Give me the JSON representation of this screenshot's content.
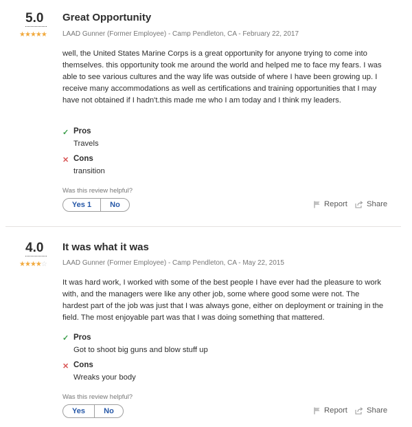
{
  "reviews": [
    {
      "rating": "5.0",
      "stars_filled": 5,
      "stars_total": 5,
      "title": "Great Opportunity",
      "meta": "LAAD Gunner (Former Employee) - Camp Pendleton, CA - February 22, 2017",
      "body": "well, the United States Marine Corps is a great opportunity for anyone trying to come into themselves. this opportunity took me around the world and helped me to face my fears. I was able to see various cultures and the way life was outside of where I have been growing up. I receive many accommodations as well as certifications and training opportunities that I may have not obtained if I hadn't.this made me who I am today and I think my leaders.",
      "pros_label": "Pros",
      "pros": "Travels",
      "cons_label": "Cons",
      "cons": "transition",
      "helpful_question": "Was this review helpful?",
      "yes_label": "Yes 1",
      "no_label": "No",
      "report_label": "Report",
      "share_label": "Share"
    },
    {
      "rating": "4.0",
      "stars_filled": 4,
      "stars_total": 5,
      "title": "It was what it was",
      "meta": "LAAD Gunner (Former Employee) - Camp Pendleton, CA - May 22, 2015",
      "body": "It was hard work, I worked with some of the best people I have ever had the pleasure to work with, and the managers were like any other job, some where good some were not. The hardest part of the job was just that I was always gone, either on deployment or training in the field. The most enjoyable part was that I was doing something that mattered.",
      "pros_label": "Pros",
      "pros": "Got to shoot big guns and blow stuff up",
      "cons_label": "Cons",
      "cons": "Wreaks your body",
      "helpful_question": "Was this review helpful?",
      "yes_label": "Yes",
      "no_label": "No",
      "report_label": "Report",
      "share_label": "Share"
    }
  ],
  "icons": {
    "pro": "checkmark-icon",
    "con": "x-icon",
    "report": "flag-icon",
    "share": "share-icon",
    "star": "star-icon"
  },
  "colors": {
    "star": "#f1a93d",
    "pro": "#3a9d49",
    "con": "#d95555",
    "vote_text": "#2557a7",
    "meta": "#767676"
  }
}
